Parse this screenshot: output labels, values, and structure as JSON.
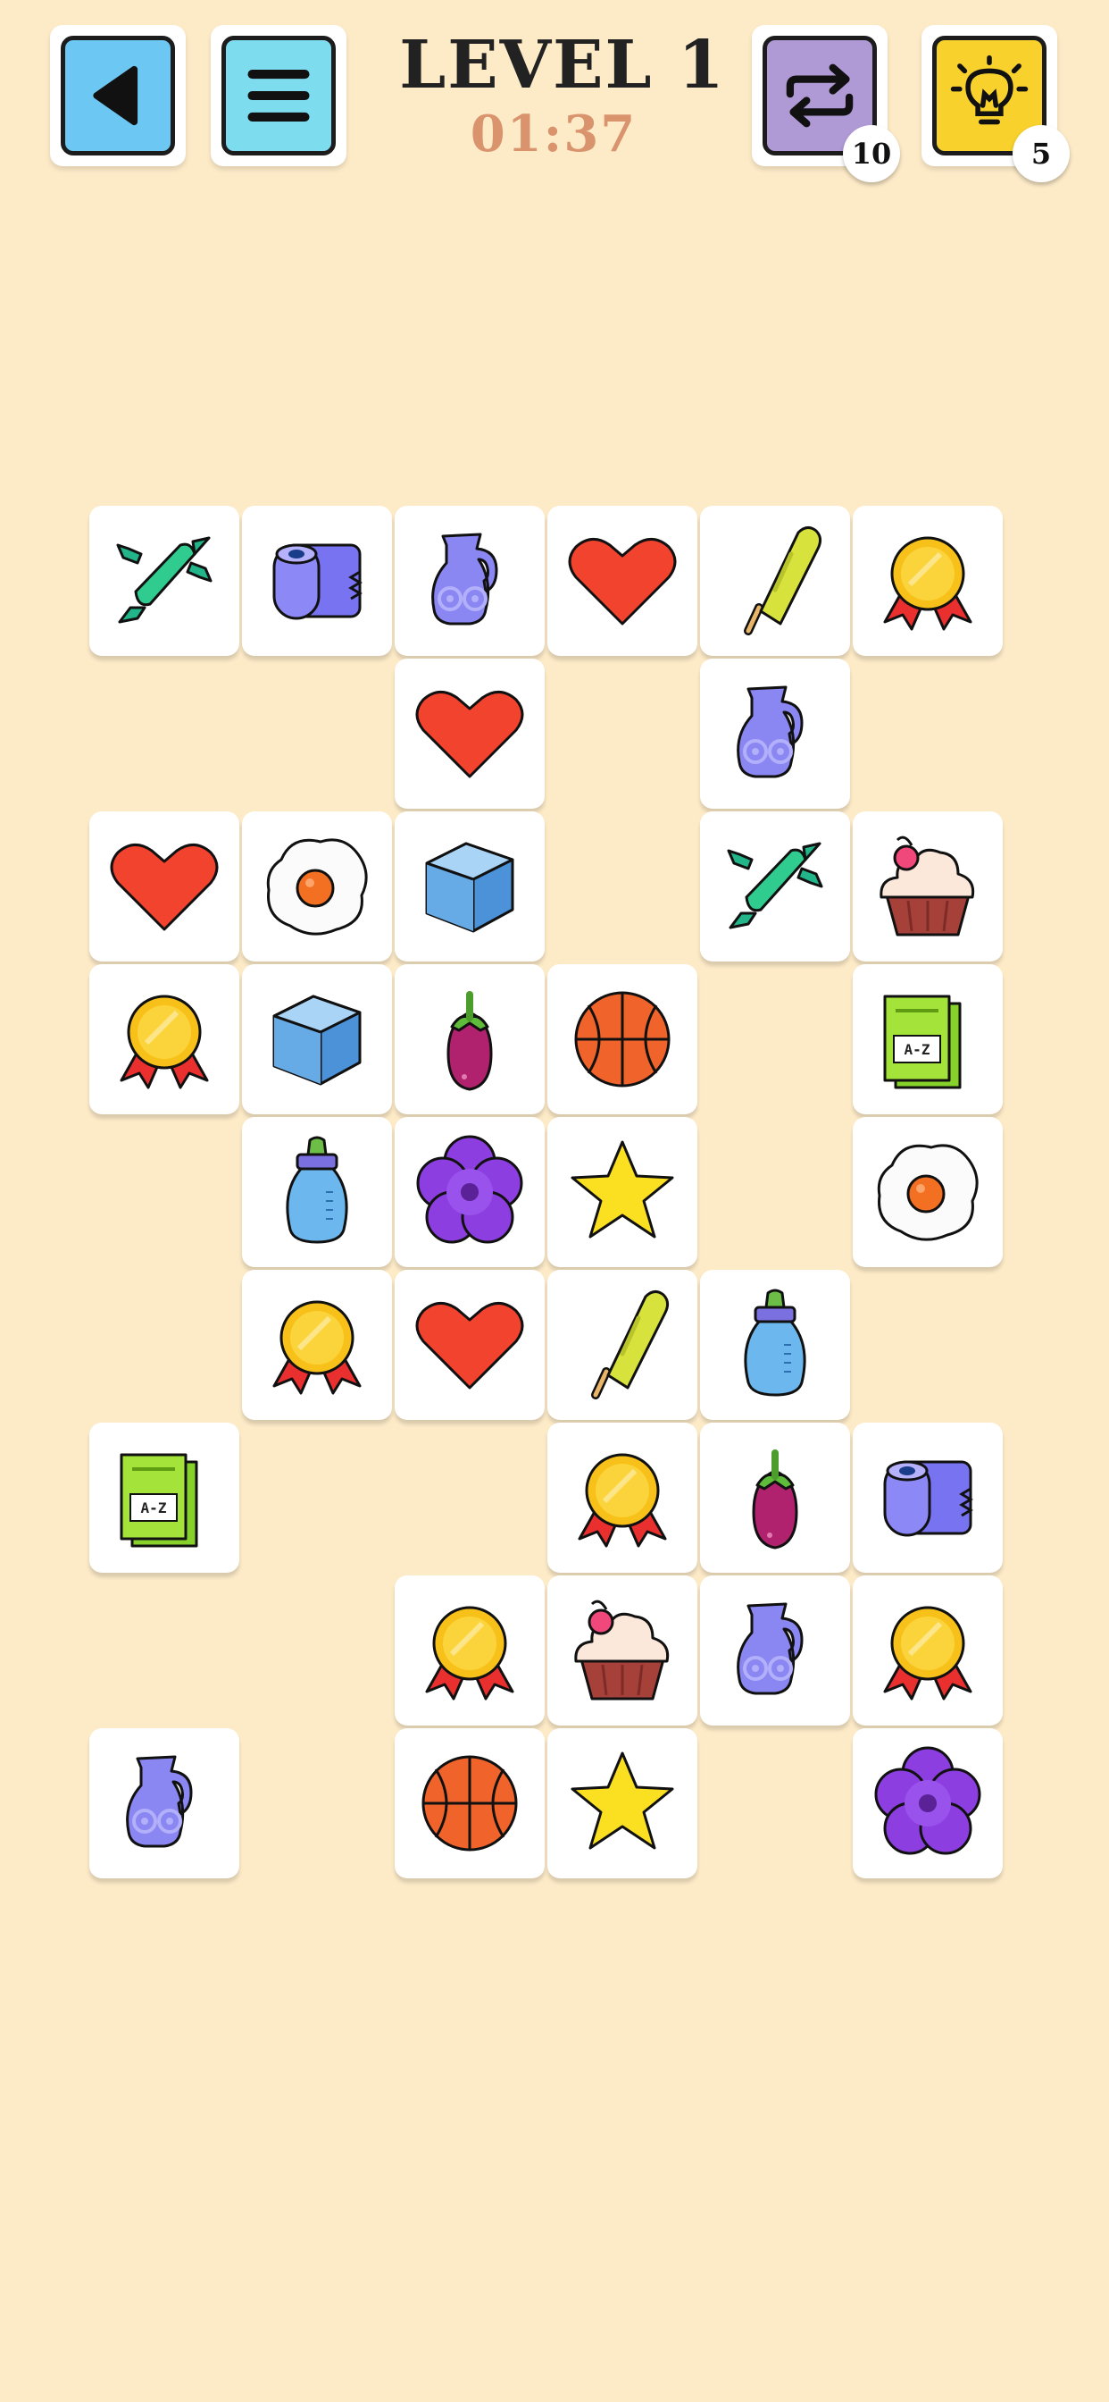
{
  "header": {
    "level_label": "LEVEL 1",
    "timer": "01:37",
    "shuffle_count": "10",
    "hint_count": "5"
  },
  "colors": {
    "background": "#fdebc8",
    "back_button": "#6cc7f2",
    "menu_button": "#7edcef",
    "shuffle_button": "#b09ad6",
    "hint_button": "#f8d12c",
    "timer_text": "#d9946e"
  },
  "board": {
    "columns": 6,
    "rows": 9,
    "tiles": [
      {
        "row": 0,
        "col": 0,
        "icon": "candy-icon"
      },
      {
        "row": 0,
        "col": 1,
        "icon": "toilet-paper-icon"
      },
      {
        "row": 0,
        "col": 2,
        "icon": "jug-icon"
      },
      {
        "row": 0,
        "col": 3,
        "icon": "heart-icon"
      },
      {
        "row": 0,
        "col": 4,
        "icon": "popsicle-icon"
      },
      {
        "row": 0,
        "col": 5,
        "icon": "medal-icon"
      },
      {
        "row": 1,
        "col": 2,
        "icon": "heart-icon"
      },
      {
        "row": 1,
        "col": 4,
        "icon": "jug-icon"
      },
      {
        "row": 2,
        "col": 0,
        "icon": "heart-icon"
      },
      {
        "row": 2,
        "col": 1,
        "icon": "fried-egg-icon"
      },
      {
        "row": 2,
        "col": 2,
        "icon": "ice-cube-icon"
      },
      {
        "row": 2,
        "col": 4,
        "icon": "candy-icon"
      },
      {
        "row": 2,
        "col": 5,
        "icon": "cupcake-icon"
      },
      {
        "row": 3,
        "col": 0,
        "icon": "medal-icon"
      },
      {
        "row": 3,
        "col": 1,
        "icon": "ice-cube-icon"
      },
      {
        "row": 3,
        "col": 2,
        "icon": "eggplant-icon"
      },
      {
        "row": 3,
        "col": 3,
        "icon": "basketball-icon"
      },
      {
        "row": 3,
        "col": 5,
        "icon": "book-icon"
      },
      {
        "row": 4,
        "col": 1,
        "icon": "baby-bottle-icon"
      },
      {
        "row": 4,
        "col": 2,
        "icon": "flower-icon"
      },
      {
        "row": 4,
        "col": 3,
        "icon": "star-icon"
      },
      {
        "row": 4,
        "col": 5,
        "icon": "fried-egg-icon"
      },
      {
        "row": 5,
        "col": 1,
        "icon": "medal-icon"
      },
      {
        "row": 5,
        "col": 2,
        "icon": "heart-icon"
      },
      {
        "row": 5,
        "col": 3,
        "icon": "popsicle-icon"
      },
      {
        "row": 5,
        "col": 4,
        "icon": "baby-bottle-icon"
      },
      {
        "row": 6,
        "col": 0,
        "icon": "book-icon"
      },
      {
        "row": 6,
        "col": 3,
        "icon": "medal-icon"
      },
      {
        "row": 6,
        "col": 4,
        "icon": "eggplant-icon"
      },
      {
        "row": 6,
        "col": 5,
        "icon": "toilet-paper-icon"
      },
      {
        "row": 7,
        "col": 2,
        "icon": "medal-icon"
      },
      {
        "row": 7,
        "col": 3,
        "icon": "cupcake-icon"
      },
      {
        "row": 7,
        "col": 4,
        "icon": "jug-icon"
      },
      {
        "row": 7,
        "col": 5,
        "icon": "medal-icon"
      },
      {
        "row": 8,
        "col": 0,
        "icon": "jug-icon"
      },
      {
        "row": 8,
        "col": 2,
        "icon": "basketball-icon"
      },
      {
        "row": 8,
        "col": 3,
        "icon": "star-icon"
      },
      {
        "row": 8,
        "col": 5,
        "icon": "flower-icon"
      }
    ],
    "book_label": "A-Z"
  }
}
